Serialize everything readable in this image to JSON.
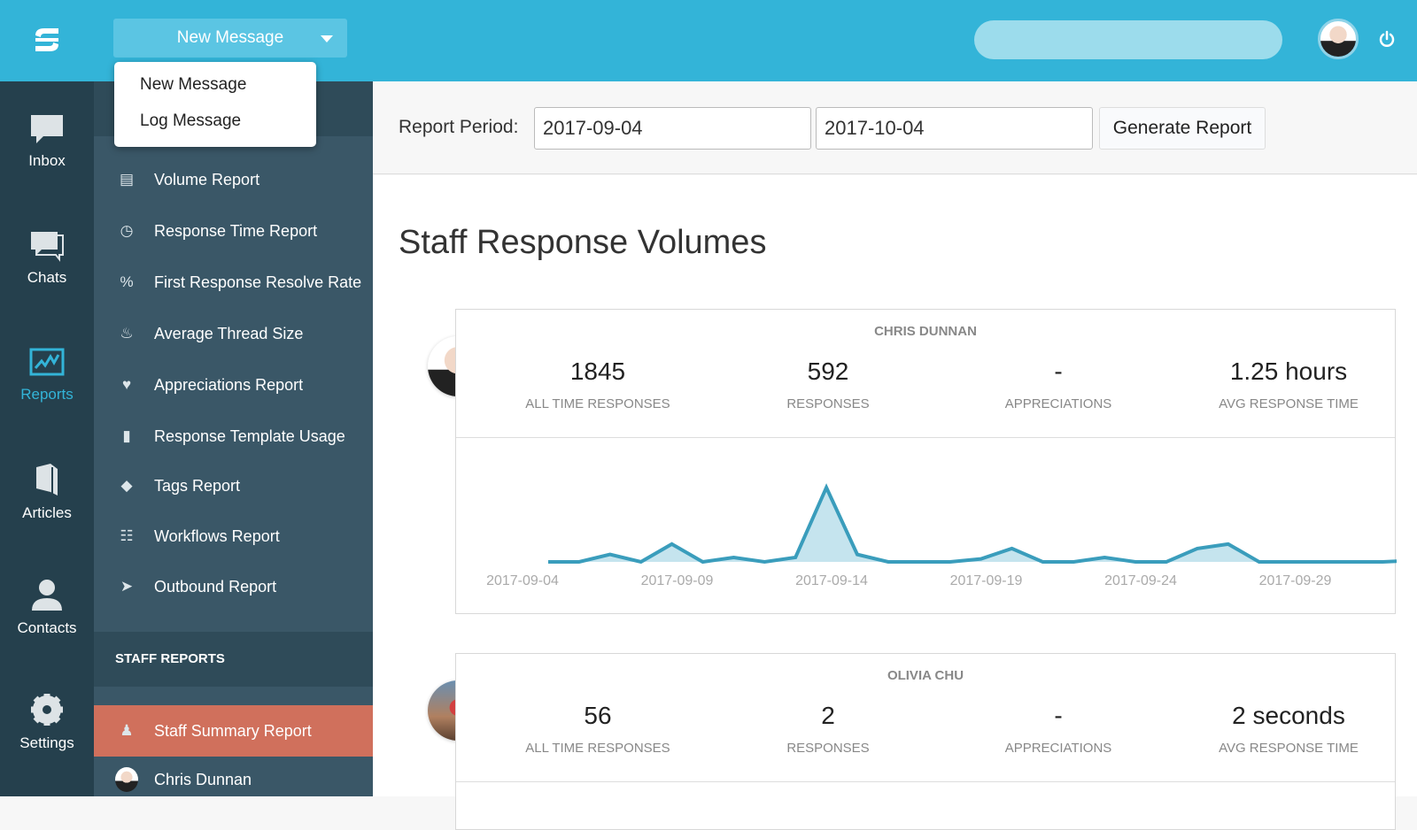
{
  "header": {
    "new_message_label": "New Message",
    "search_placeholder": "",
    "dropdown": [
      "New Message",
      "Log Message"
    ]
  },
  "rail": [
    {
      "label": "Inbox",
      "icon": "inbox-icon"
    },
    {
      "label": "Chats",
      "icon": "chats-icon"
    },
    {
      "label": "Reports",
      "icon": "reports-icon",
      "active": true
    },
    {
      "label": "Articles",
      "icon": "articles-icon"
    },
    {
      "label": "Contacts",
      "icon": "contacts-icon"
    },
    {
      "label": "Settings",
      "icon": "settings-icon"
    }
  ],
  "subnav": {
    "items": [
      "Volume Report",
      "Response Time Report",
      "First Response Resolve Rate",
      "Average Thread Size",
      "Appreciations Report",
      "Response Template Usage",
      "Tags Report",
      "Workflows Report",
      "Outbound Report"
    ],
    "staff_heading": "STAFF REPORTS",
    "staff_active": "Staff Summary Report",
    "staff_user": "Chris Dunnan"
  },
  "filter": {
    "label": "Report Period:",
    "start": "2017-09-04",
    "end": "2017-10-04",
    "button": "Generate Report"
  },
  "main": {
    "title": "Staff Response Volumes",
    "cards": [
      {
        "name": "CHRIS DUNNAN",
        "stats": [
          {
            "value": "1845",
            "label": "ALL TIME RESPONSES"
          },
          {
            "value": "592",
            "label": "RESPONSES"
          },
          {
            "value": "-",
            "label": "APPRECIATIONS"
          },
          {
            "value": "1.25 hours",
            "label": "AVG RESPONSE TIME"
          }
        ]
      },
      {
        "name": "OLIVIA CHU",
        "stats": [
          {
            "value": "56",
            "label": "ALL TIME RESPONSES"
          },
          {
            "value": "2",
            "label": "RESPONSES"
          },
          {
            "value": "-",
            "label": "APPRECIATIONS"
          },
          {
            "value": "2 seconds",
            "label": "AVG RESPONSE TIME"
          }
        ]
      }
    ]
  },
  "colors": {
    "accent": "#33b4d8",
    "active": "#d0705c",
    "line": "#3a9dbc",
    "fill": "#c5e4ee"
  },
  "chart_data": {
    "type": "area",
    "x_tick_labels": [
      "2017-09-04",
      "2017-09-09",
      "2017-09-14",
      "2017-09-19",
      "2017-09-24",
      "2017-09-29"
    ],
    "x": [
      "2017-09-05",
      "2017-09-06",
      "2017-09-07",
      "2017-09-08",
      "2017-09-09",
      "2017-09-10",
      "2017-09-11",
      "2017-09-12",
      "2017-09-13",
      "2017-09-14",
      "2017-09-15",
      "2017-09-16",
      "2017-09-17",
      "2017-09-18",
      "2017-09-19",
      "2017-09-20",
      "2017-09-21",
      "2017-09-22",
      "2017-09-23",
      "2017-09-24",
      "2017-09-25",
      "2017-09-26",
      "2017-09-27",
      "2017-09-28",
      "2017-09-29",
      "2017-09-30",
      "2017-10-01",
      "2017-10-02",
      "2017-10-03"
    ],
    "values": [
      0,
      0,
      5,
      0,
      12,
      0,
      3,
      0,
      3,
      50,
      5,
      0,
      0,
      0,
      2,
      9,
      0,
      0,
      3,
      0,
      0,
      9,
      12,
      0,
      0,
      0,
      0,
      0,
      1
    ],
    "grid": false
  }
}
